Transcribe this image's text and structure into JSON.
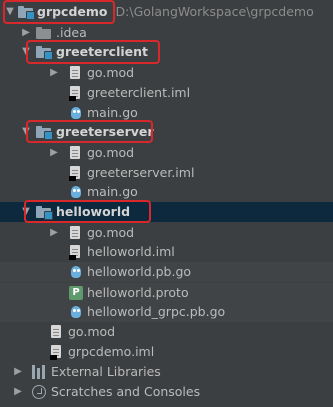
{
  "project": {
    "name": "grpcdemo",
    "path": "D:\\GolangWorkspace\\grpcdemo",
    "items": [
      {
        "label": ".idea"
      },
      {
        "label": "greeterclient",
        "children": [
          "go.mod",
          "greeterclient.iml",
          "main.go"
        ]
      },
      {
        "label": "greeterserver",
        "children": [
          "go.mod",
          "greeterserver.iml",
          "main.go"
        ]
      },
      {
        "label": "helloworld",
        "children": [
          "go.mod",
          "helloworld.iml",
          "helloworld.pb.go",
          "helloworld.proto",
          "helloworld_grpc.pb.go"
        ]
      },
      {
        "label": "go.mod"
      },
      {
        "label": "grpcdemo.iml"
      }
    ]
  },
  "external_libraries": "External Libraries",
  "scratches": "Scratches and Consoles",
  "colors": {
    "highlight": "#d8282b",
    "selection": "#0d293e",
    "module_marker": "#3592c4"
  }
}
